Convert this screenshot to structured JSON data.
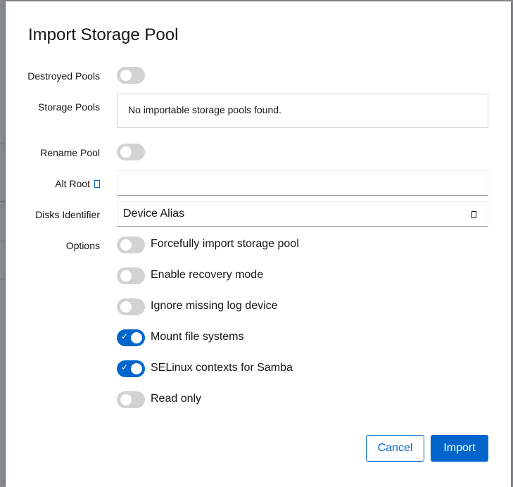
{
  "dialog": {
    "title": "Import Storage Pool",
    "destroyed_pools": {
      "label": "Destroyed Pools",
      "on": false
    },
    "storage_pools": {
      "label": "Storage Pools",
      "message": "No importable storage pools found."
    },
    "rename_pool": {
      "label": "Rename Pool",
      "on": false
    },
    "alt_root": {
      "label": "Alt Root",
      "help_icon": "help-icon",
      "value": ""
    },
    "disks_identifier": {
      "label": "Disks Identifier",
      "selected": "Device Alias"
    },
    "options": {
      "label": "Options",
      "items": [
        {
          "label": "Forcefully import storage pool",
          "on": false
        },
        {
          "label": "Enable recovery mode",
          "on": false
        },
        {
          "label": "Ignore missing log device",
          "on": false
        },
        {
          "label": "Mount file systems",
          "on": true
        },
        {
          "label": "SELinux contexts for Samba",
          "on": true
        },
        {
          "label": "Read only",
          "on": false
        }
      ]
    },
    "buttons": {
      "cancel": "Cancel",
      "import": "Import"
    }
  },
  "colors": {
    "accent": "#0066cc",
    "switch_off": "#d2d2d2"
  }
}
